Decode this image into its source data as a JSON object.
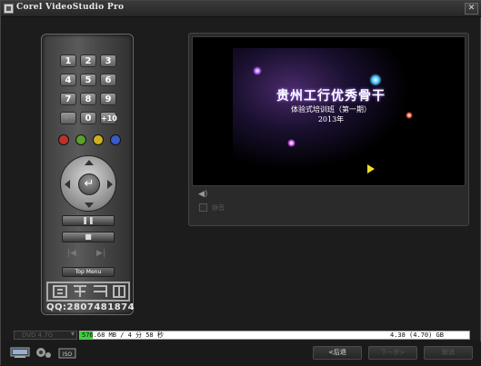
{
  "window": {
    "title": "Corel VideoStudio Pro",
    "close_glyph": "✕"
  },
  "remote": {
    "keys": [
      "1",
      "2",
      "3",
      "4",
      "5",
      "6",
      "7",
      "8",
      "9",
      "↶",
      "0",
      "+10"
    ],
    "color_buttons": [
      "#c0302a",
      "#5aa02a",
      "#d0b020",
      "#3a5ac8"
    ],
    "dpad_center_glyph": "↵",
    "pause_glyph": "❚❚",
    "stop_glyph": "■",
    "prev_glyph": "|◀",
    "next_glyph": "▶|",
    "top_menu_label": "Top Menu"
  },
  "watermark": {
    "qq": "QQ:2807481874"
  },
  "preview": {
    "title": "贵州工行优秀骨干",
    "subtitle": "体验式培训班（第一期）",
    "year": "2013年",
    "volume_icon": "speaker-icon",
    "mute_label": "静音"
  },
  "status": {
    "disc_type": "DVD 4.7G",
    "used_text": "576.68 MB / 4 分 58 秒",
    "total_text": "4.38 (4.70) GB",
    "used_fraction": 0.033,
    "fill_color": "#3ad23a"
  },
  "footer": {
    "back_label": "<后退",
    "next_label": "下一步>",
    "cancel_label": "取消"
  }
}
